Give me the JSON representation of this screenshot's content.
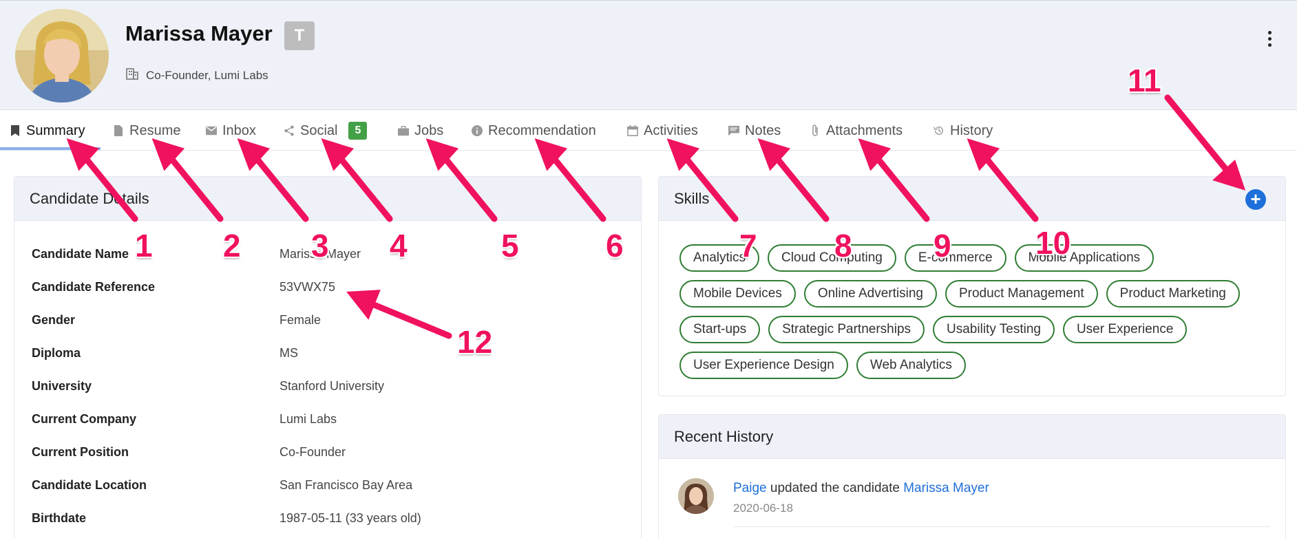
{
  "profile": {
    "name": "Marissa Mayer",
    "name_badge": "T",
    "subtitle": "Co-Founder, Lumi Labs",
    "company_icon": "building-icon",
    "more_icon": "more-vertical-icon"
  },
  "tabs": [
    {
      "label": "Summary",
      "icon": "bookmark-icon",
      "active": true
    },
    {
      "label": "Resume",
      "icon": "document-icon"
    },
    {
      "label": "Inbox",
      "icon": "envelope-icon"
    },
    {
      "label": "Social",
      "icon": "share-icon",
      "badge": "5"
    },
    {
      "label": "Jobs",
      "icon": "briefcase-icon"
    },
    {
      "label": "Recommendation",
      "icon": "info-icon"
    },
    {
      "label": "Activities",
      "icon": "calendar-icon"
    },
    {
      "label": "Notes",
      "icon": "chat-icon"
    },
    {
      "label": "Attachments",
      "icon": "paperclip-icon"
    },
    {
      "label": "History",
      "icon": "history-icon"
    }
  ],
  "details": {
    "title": "Candidate Details",
    "rows": [
      {
        "label": "Candidate Name",
        "value": "Marissa Mayer"
      },
      {
        "label": "Candidate Reference",
        "value": "53VWX75"
      },
      {
        "label": "Gender",
        "value": "Female"
      },
      {
        "label": "Diploma",
        "value": "MS"
      },
      {
        "label": "University",
        "value": "Stanford University"
      },
      {
        "label": "Current Company",
        "value": "Lumi Labs"
      },
      {
        "label": "Current Position",
        "value": "Co-Founder"
      },
      {
        "label": "Candidate Location",
        "value": "San Francisco Bay Area"
      },
      {
        "label": "Birthdate",
        "value": "1987-05-11 (33 years old)"
      }
    ]
  },
  "skills": {
    "title": "Skills",
    "add_label": "+",
    "items": [
      "Analytics",
      "Cloud Computing",
      "E-commerce",
      "Mobile Applications",
      "Mobile Devices",
      "Online Advertising",
      "Product Management",
      "Product Marketing",
      "Start-ups",
      "Strategic Partnerships",
      "Usability Testing",
      "User Experience",
      "User Experience Design",
      "Web Analytics"
    ]
  },
  "history": {
    "title": "Recent History",
    "entry": {
      "user": "Paige",
      "action": " updated the candidate ",
      "target": "Marissa Mayer",
      "date": "2020-06-18"
    }
  },
  "annotations": [
    "1",
    "2",
    "3",
    "4",
    "5",
    "6",
    "7",
    "8",
    "9",
    "10",
    "11",
    "12"
  ],
  "colors": {
    "accent_blue": "#1e6fd9",
    "chip_border": "#2e7d32",
    "badge_green": "#43a047",
    "annotation_pink": "#f0115f",
    "header_bg": "#eef1f7"
  }
}
